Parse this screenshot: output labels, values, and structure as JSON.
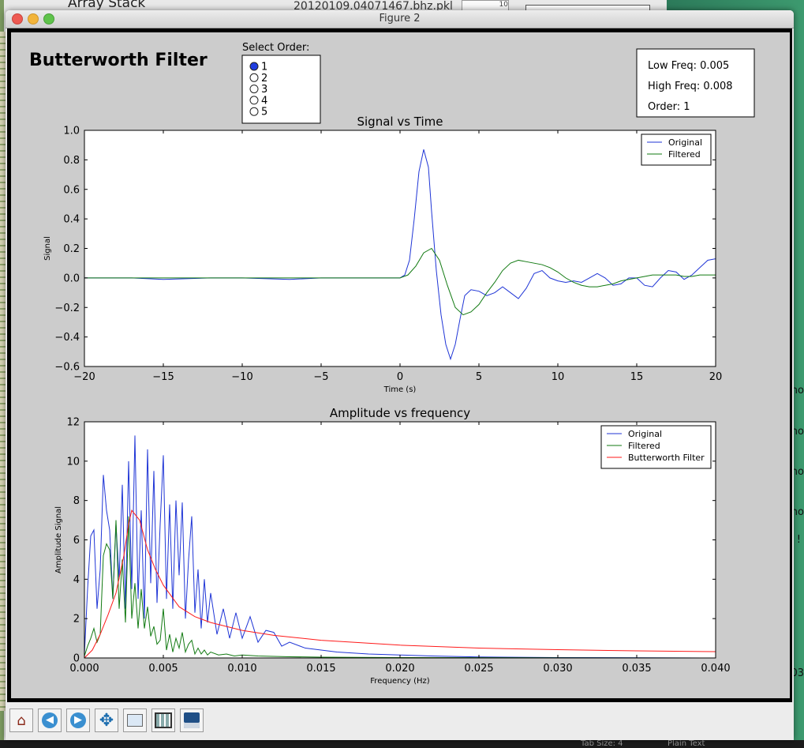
{
  "background": {
    "left_title": "Array Stack",
    "file_name": "20120109.04071467.bhz.pkl",
    "right_snippets": [
      "ho",
      "ho",
      "ho",
      "ho",
      "!",
      "03"
    ],
    "status_tab_size": "Tab Size: 4",
    "status_plain_text": "Plain Text",
    "corner_value": "10"
  },
  "window": {
    "title": "Figure 2"
  },
  "figure": {
    "heading": "Butterworth Filter",
    "order_selector": {
      "label": "Select Order:",
      "options": [
        "1",
        "2",
        "3",
        "4",
        "5"
      ],
      "selected": "1"
    },
    "info_box": {
      "low_freq": "Low Freq: 0.005",
      "high_freq": "High Freq: 0.008",
      "order": "Order: 1"
    }
  },
  "toolbar": {
    "buttons": [
      {
        "name": "home-button",
        "icon": "home-icon"
      },
      {
        "name": "back-button",
        "icon": "arrow-left-icon"
      },
      {
        "name": "forward-button",
        "icon": "arrow-right-icon"
      },
      {
        "name": "pan-button",
        "icon": "move-icon"
      },
      {
        "name": "zoom-button",
        "icon": "zoom-rect-icon"
      },
      {
        "name": "subplots-button",
        "icon": "subplots-icon"
      },
      {
        "name": "save-button",
        "icon": "save-icon"
      }
    ]
  },
  "colors": {
    "original": "#1f35d6",
    "filtered": "#127a12",
    "butterworth": "#ff1a1a",
    "radio_selected": "#1f3de0"
  },
  "chart_data": [
    {
      "type": "line",
      "title": "Signal vs Time",
      "xlabel": "Time (s)",
      "ylabel": "Signal",
      "xlim": [
        -20,
        20
      ],
      "ylim": [
        -0.6,
        1.0
      ],
      "xticks": [
        -20,
        -15,
        -10,
        -5,
        0,
        5,
        10,
        15,
        20
      ],
      "xtick_labels": [
        "−20",
        "−15",
        "−10",
        "−5",
        "0",
        "5",
        "10",
        "15",
        "20"
      ],
      "yticks": [
        -0.6,
        -0.4,
        -0.2,
        0.0,
        0.2,
        0.4,
        0.6,
        0.8,
        1.0
      ],
      "ytick_labels": [
        "−0.6",
        "−0.4",
        "−0.2",
        "0.0",
        "0.2",
        "0.4",
        "0.6",
        "0.8",
        "1.0"
      ],
      "legend_position": "top-right",
      "grid": false,
      "series": [
        {
          "name": "Original",
          "color": "#1f35d6",
          "x": [
            -20,
            -17,
            -15,
            -12,
            -10,
            -7,
            -5,
            -3,
            -1,
            0,
            0.3,
            0.6,
            0.9,
            1.2,
            1.5,
            1.8,
            2.0,
            2.3,
            2.6,
            2.9,
            3.2,
            3.5,
            3.8,
            4.1,
            4.5,
            5.0,
            5.5,
            6.0,
            6.5,
            7.0,
            7.5,
            8.0,
            8.5,
            9.0,
            9.5,
            10.0,
            10.5,
            11.0,
            11.5,
            12.0,
            12.5,
            13.0,
            13.5,
            14.0,
            14.5,
            15.0,
            15.5,
            16.0,
            16.5,
            17.0,
            17.5,
            18.0,
            18.5,
            19.0,
            19.5,
            20.0
          ],
          "y": [
            0.0,
            0.0,
            -0.01,
            0.0,
            0.0,
            -0.01,
            0.0,
            0.0,
            0.0,
            0.0,
            0.02,
            0.12,
            0.4,
            0.72,
            0.87,
            0.75,
            0.45,
            0.05,
            -0.25,
            -0.45,
            -0.55,
            -0.45,
            -0.28,
            -0.12,
            -0.08,
            -0.09,
            -0.12,
            -0.1,
            -0.06,
            -0.1,
            -0.14,
            -0.07,
            0.03,
            0.05,
            0.0,
            -0.02,
            -0.03,
            -0.02,
            -0.03,
            0.0,
            0.03,
            0.0,
            -0.05,
            -0.04,
            0.0,
            0.0,
            -0.05,
            -0.06,
            0.0,
            0.05,
            0.04,
            -0.01,
            0.02,
            0.07,
            0.12,
            0.13
          ]
        },
        {
          "name": "Filtered",
          "color": "#127a12",
          "x": [
            -20,
            -17,
            -15,
            -12,
            -10,
            -7,
            -5,
            -3,
            -1,
            0,
            0.5,
            1.0,
            1.5,
            2.0,
            2.5,
            3.0,
            3.5,
            4.0,
            4.5,
            5.0,
            5.5,
            6.0,
            6.5,
            7.0,
            7.5,
            8.0,
            8.5,
            9.0,
            9.5,
            10.0,
            10.5,
            11.0,
            11.5,
            12.0,
            12.5,
            13.0,
            13.5,
            14.0,
            14.5,
            15.0,
            15.5,
            16.0,
            16.5,
            17.0,
            17.5,
            18.0,
            18.5,
            19.0,
            19.5,
            20.0
          ],
          "y": [
            0.0,
            0.0,
            0.0,
            0.0,
            0.0,
            0.0,
            0.0,
            0.0,
            0.0,
            0.0,
            0.02,
            0.08,
            0.17,
            0.2,
            0.12,
            -0.05,
            -0.2,
            -0.25,
            -0.23,
            -0.18,
            -0.1,
            -0.03,
            0.05,
            0.1,
            0.12,
            0.11,
            0.1,
            0.09,
            0.07,
            0.04,
            0.0,
            -0.03,
            -0.05,
            -0.06,
            -0.06,
            -0.05,
            -0.04,
            -0.02,
            -0.01,
            0.0,
            0.01,
            0.02,
            0.02,
            0.02,
            0.02,
            0.01,
            0.01,
            0.02,
            0.02,
            0.02
          ]
        }
      ]
    },
    {
      "type": "line",
      "title": "Amplitude vs frequency",
      "xlabel": "Frequency (Hz)",
      "ylabel": "Amplitude Signal",
      "xlim": [
        0.0,
        0.04
      ],
      "ylim": [
        0,
        12
      ],
      "xticks": [
        0.0,
        0.005,
        0.01,
        0.015,
        0.02,
        0.025,
        0.03,
        0.035,
        0.04
      ],
      "xtick_labels": [
        "0.000",
        "0.005",
        "0.010",
        "0.015",
        "0.020",
        "0.025",
        "0.030",
        "0.035",
        "0.040"
      ],
      "yticks": [
        0,
        2,
        4,
        6,
        8,
        10,
        12
      ],
      "ytick_labels": [
        "0",
        "2",
        "4",
        "6",
        "8",
        "10",
        "12"
      ],
      "legend_position": "top-right",
      "grid": false,
      "series": [
        {
          "name": "Original",
          "color": "#1f35d6",
          "x": [
            0.0,
            0.0002,
            0.0004,
            0.0006,
            0.0008,
            0.001,
            0.0012,
            0.0014,
            0.0016,
            0.0018,
            0.002,
            0.0022,
            0.0024,
            0.0026,
            0.0028,
            0.003,
            0.0032,
            0.0034,
            0.0036,
            0.0038,
            0.004,
            0.0042,
            0.0044,
            0.0046,
            0.0048,
            0.005,
            0.0052,
            0.0054,
            0.0056,
            0.0058,
            0.006,
            0.0062,
            0.0064,
            0.0066,
            0.0068,
            0.007,
            0.0072,
            0.0074,
            0.0076,
            0.0078,
            0.008,
            0.0084,
            0.0088,
            0.0092,
            0.0096,
            0.01,
            0.0105,
            0.011,
            0.0115,
            0.012,
            0.0125,
            0.013,
            0.014,
            0.015,
            0.016,
            0.017,
            0.018,
            0.02,
            0.022,
            0.025,
            0.03,
            0.035,
            0.04
          ],
          "y": [
            0.2,
            3.5,
            6.2,
            6.5,
            2.5,
            4.5,
            9.3,
            7.5,
            6.5,
            3.0,
            6.8,
            4.0,
            8.8,
            2.5,
            10.0,
            3.5,
            11.3,
            3.0,
            7.5,
            2.0,
            10.6,
            3.8,
            9.5,
            2.8,
            6.8,
            10.3,
            3.0,
            7.8,
            2.5,
            8.0,
            4.2,
            7.9,
            2.0,
            5.0,
            7.2,
            2.3,
            4.5,
            1.5,
            4.0,
            1.8,
            3.3,
            1.2,
            2.5,
            1.0,
            2.3,
            1.0,
            2.1,
            0.8,
            1.4,
            1.3,
            0.6,
            0.8,
            0.5,
            0.4,
            0.3,
            0.25,
            0.2,
            0.15,
            0.1,
            0.05,
            0.02,
            0.01,
            0.0
          ]
        },
        {
          "name": "Filtered",
          "color": "#127a12",
          "x": [
            0.0,
            0.0002,
            0.0004,
            0.0006,
            0.0008,
            0.001,
            0.0012,
            0.0014,
            0.0016,
            0.0018,
            0.002,
            0.0022,
            0.0024,
            0.0026,
            0.0028,
            0.003,
            0.0032,
            0.0034,
            0.0036,
            0.0038,
            0.004,
            0.0042,
            0.0044,
            0.0046,
            0.0048,
            0.005,
            0.0052,
            0.0054,
            0.0056,
            0.0058,
            0.006,
            0.0062,
            0.0064,
            0.0066,
            0.0068,
            0.007,
            0.0072,
            0.0074,
            0.0076,
            0.0078,
            0.008,
            0.0085,
            0.009,
            0.0095,
            0.01,
            0.011,
            0.012,
            0.013,
            0.015,
            0.02,
            0.03,
            0.04
          ],
          "y": [
            0.1,
            0.6,
            1.0,
            1.5,
            0.8,
            1.2,
            5.2,
            5.8,
            5.5,
            3.0,
            7.0,
            2.5,
            5.0,
            1.8,
            7.2,
            2.0,
            3.8,
            1.5,
            3.5,
            1.5,
            2.6,
            1.1,
            1.6,
            0.7,
            0.9,
            2.5,
            0.4,
            1.2,
            0.3,
            1.0,
            0.5,
            1.3,
            0.3,
            0.7,
            0.9,
            0.2,
            0.5,
            0.2,
            0.4,
            0.15,
            0.3,
            0.15,
            0.2,
            0.1,
            0.15,
            0.1,
            0.08,
            0.06,
            0.04,
            0.02,
            0.01,
            0.0
          ]
        },
        {
          "name": "Butterworth Filter",
          "color": "#ff1a1a",
          "x": [
            0.0,
            0.0005,
            0.001,
            0.0015,
            0.002,
            0.0025,
            0.0028,
            0.003,
            0.0035,
            0.004,
            0.0045,
            0.005,
            0.006,
            0.007,
            0.008,
            0.01,
            0.012,
            0.015,
            0.02,
            0.025,
            0.03,
            0.035,
            0.04
          ],
          "y": [
            0.0,
            0.4,
            1.2,
            2.2,
            3.3,
            5.2,
            6.8,
            7.5,
            7.0,
            5.5,
            4.5,
            3.7,
            2.6,
            2.1,
            1.8,
            1.4,
            1.15,
            0.9,
            0.65,
            0.5,
            0.42,
            0.36,
            0.32
          ]
        }
      ]
    }
  ]
}
